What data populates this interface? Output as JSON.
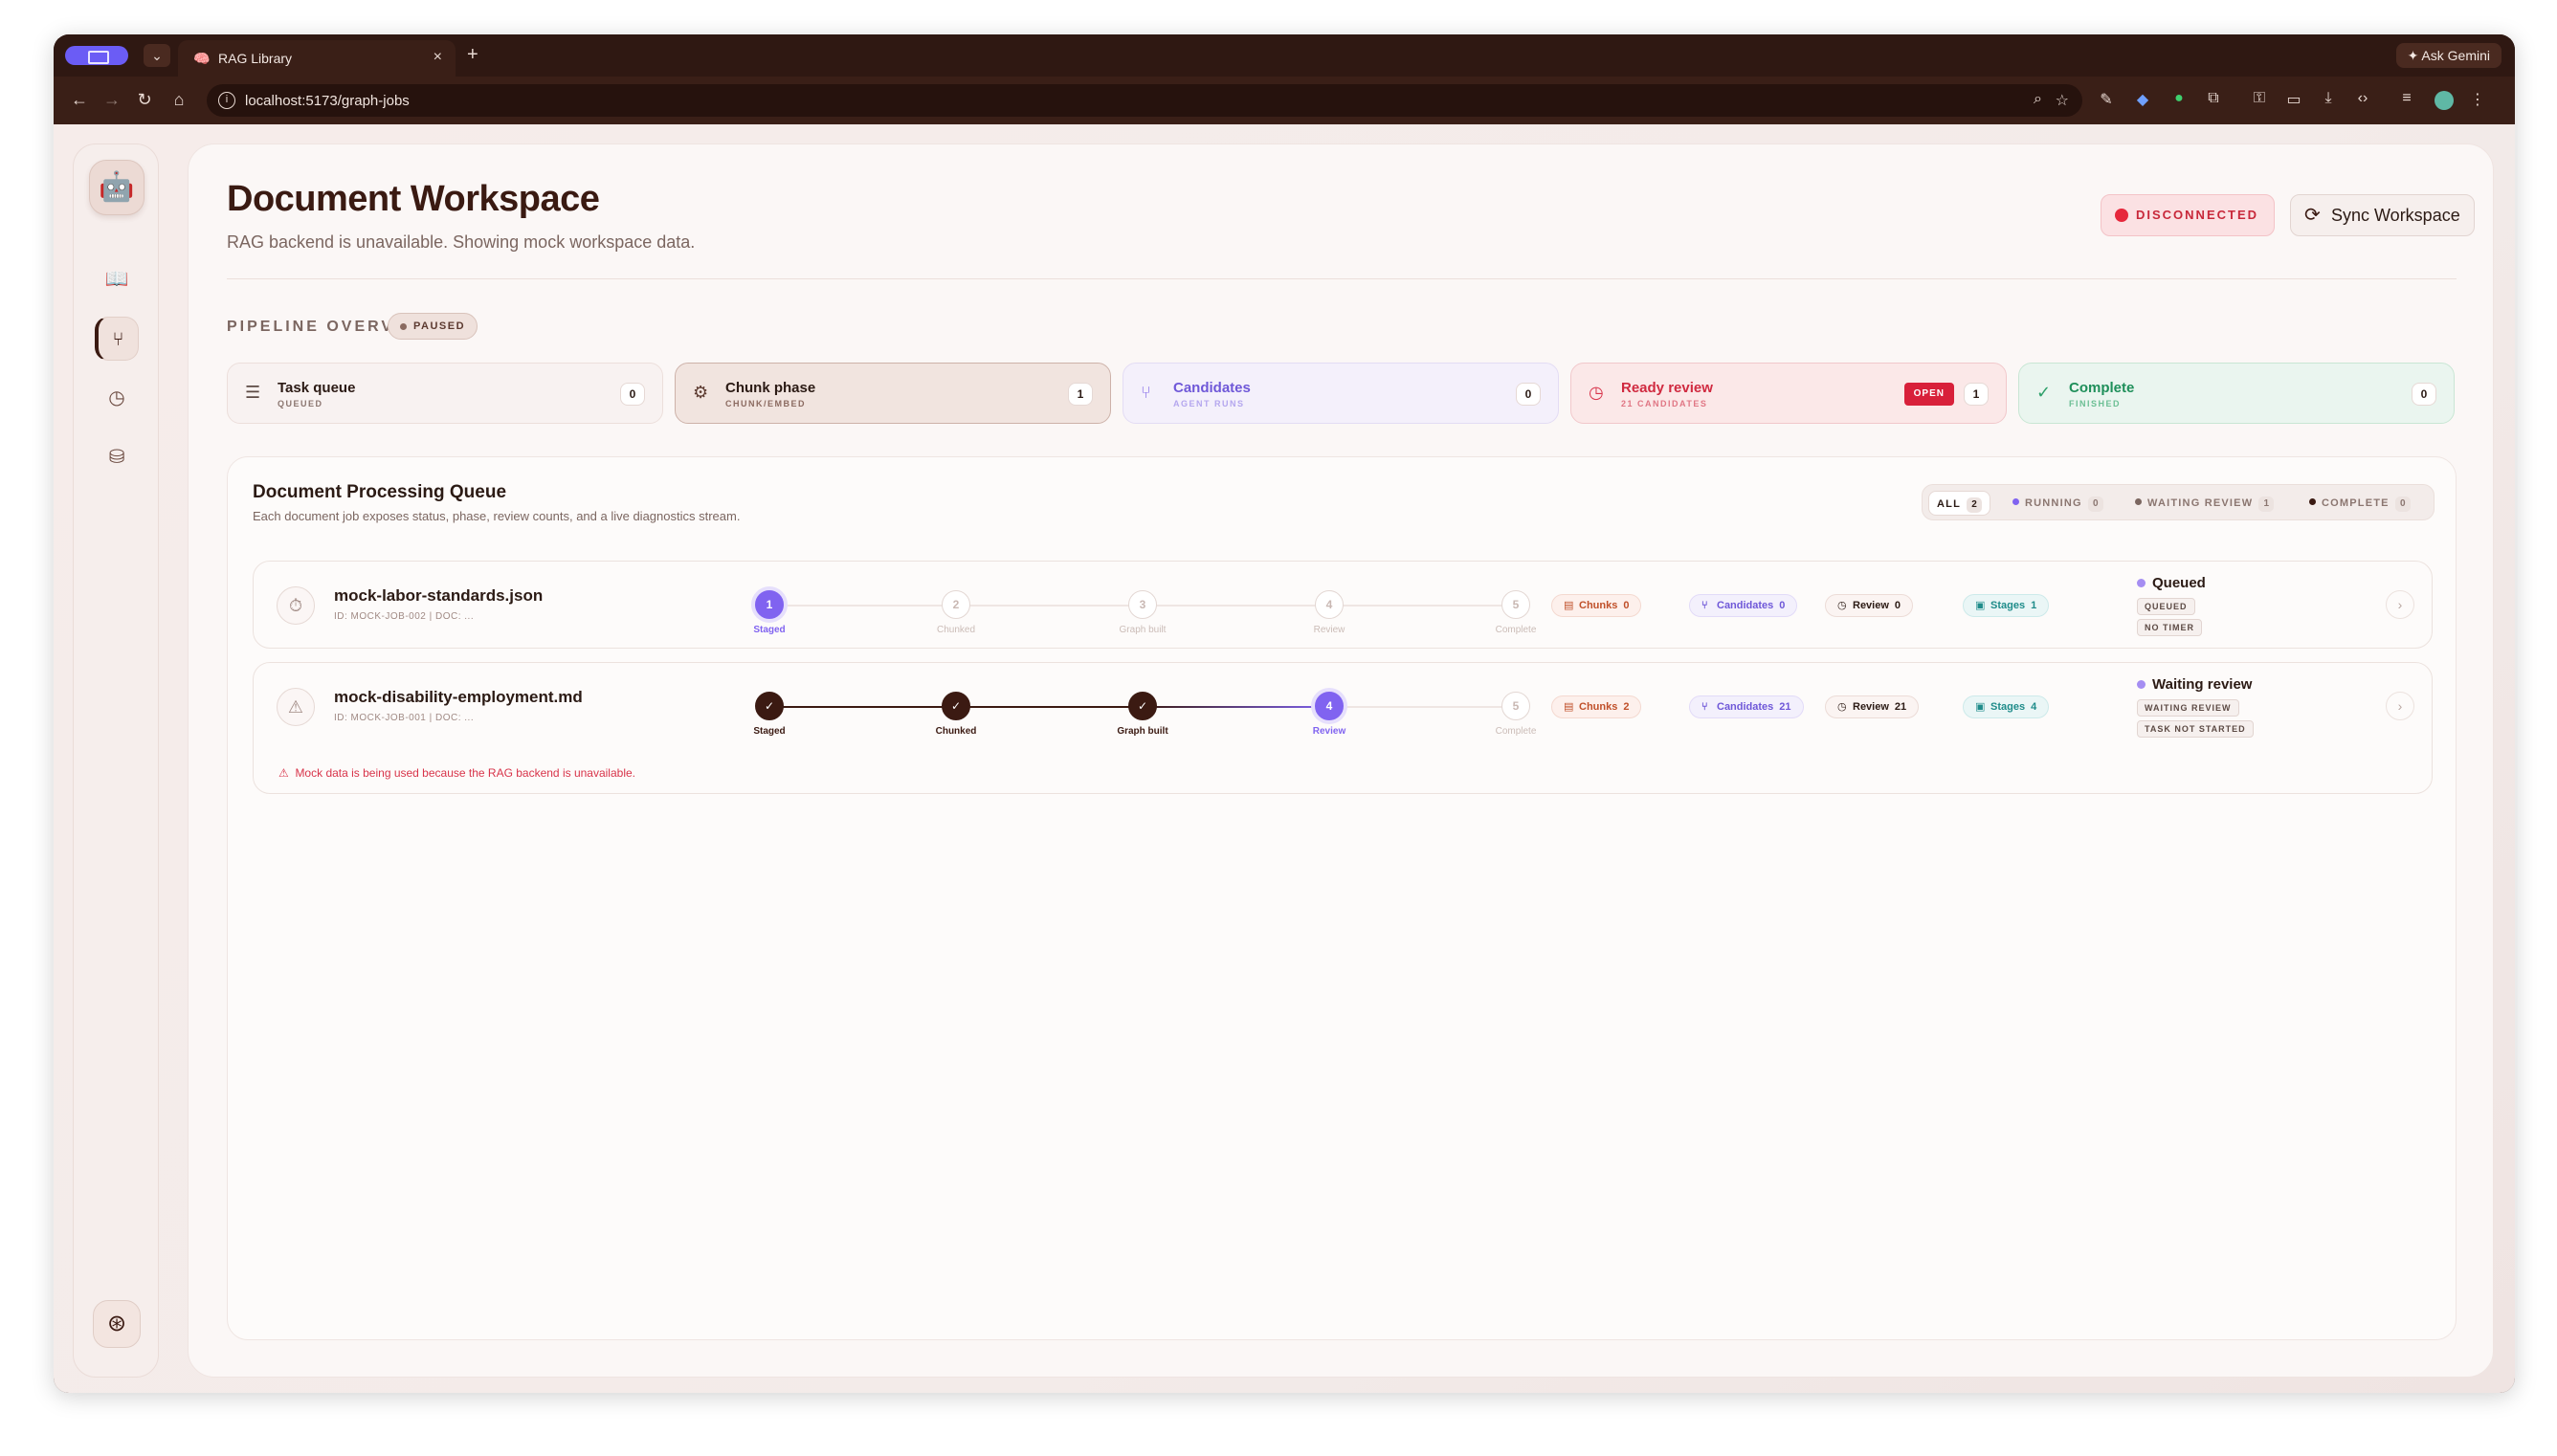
{
  "browser": {
    "tab_title": "RAG Library",
    "tab_favicon": "🧠",
    "url": "localhost:5173/graph-jobs",
    "ask_gemini": "Ask Gemini"
  },
  "sidebar": {
    "avatar": "🤖",
    "items": [
      {
        "icon": "book-icon",
        "glyph": "📖"
      },
      {
        "icon": "branch-icon",
        "glyph": "⑂"
      },
      {
        "icon": "clock-icon",
        "glyph": "◷"
      },
      {
        "icon": "database-icon",
        "glyph": "⛁"
      }
    ],
    "brain_glyph": "⊛"
  },
  "header": {
    "title": "Document Workspace",
    "subtitle": "RAG backend is unavailable. Showing mock workspace data.",
    "status_label": "DISCONNECTED",
    "sync_label": "Sync Workspace",
    "sync_glyph": "⟳"
  },
  "pipeline": {
    "label": "PIPELINE OVERVIEW",
    "state": "PAUSED",
    "stats": [
      {
        "title": "Task queue",
        "sub": "QUEUED",
        "count": "0",
        "glyph": "☰"
      },
      {
        "title": "Chunk phase",
        "sub": "CHUNK/EMBED",
        "count": "1",
        "glyph": "⚙"
      },
      {
        "title": "Candidates",
        "sub": "AGENT RUNS",
        "count": "0",
        "glyph": "⑂"
      },
      {
        "title": "Ready review",
        "sub": "21 CANDIDATES",
        "count": "1",
        "glyph": "◷",
        "badge": "OPEN"
      },
      {
        "title": "Complete",
        "sub": "FINISHED",
        "count": "0",
        "glyph": "✓"
      }
    ]
  },
  "queue": {
    "title": "Document Processing Queue",
    "subtitle": "Each document job exposes status, phase, review counts, and a live diagnostics stream.",
    "filters": [
      {
        "label": "ALL",
        "count": "2"
      },
      {
        "label": "RUNNING",
        "count": "0"
      },
      {
        "label": "WAITING REVIEW",
        "count": "1"
      },
      {
        "label": "COMPLETE",
        "count": "0"
      }
    ],
    "steps": [
      "Staged",
      "Chunked",
      "Graph built",
      "Review",
      "Complete"
    ],
    "jobs": [
      {
        "name": "mock-labor-standards.json",
        "id_line": "ID: MOCK-JOB-002 | DOC: ...",
        "icon": "⏱",
        "step_numbers": [
          "1",
          "2",
          "3",
          "4",
          "5"
        ],
        "metrics": {
          "chunks": "0",
          "candidates": "0",
          "review": "0",
          "stages": "1"
        },
        "status": "Queued",
        "tags": [
          "QUEUED",
          "NO TIMER"
        ]
      },
      {
        "name": "mock-disability-employment.md",
        "id_line": "ID: MOCK-JOB-001 | DOC: ...",
        "icon": "⚠",
        "step_numbers": [
          "✓",
          "✓",
          "✓",
          "4",
          "5"
        ],
        "metrics": {
          "chunks": "2",
          "candidates": "21",
          "review": "21",
          "stages": "4"
        },
        "status": "Waiting review",
        "tags": [
          "WAITING REVIEW",
          "TASK NOT STARTED"
        ],
        "warning": "Mock data is being used because the RAG backend is unavailable."
      }
    ],
    "metric_labels": {
      "chunks": "Chunks",
      "candidates": "Candidates",
      "review": "Review",
      "stages": "Stages"
    }
  }
}
